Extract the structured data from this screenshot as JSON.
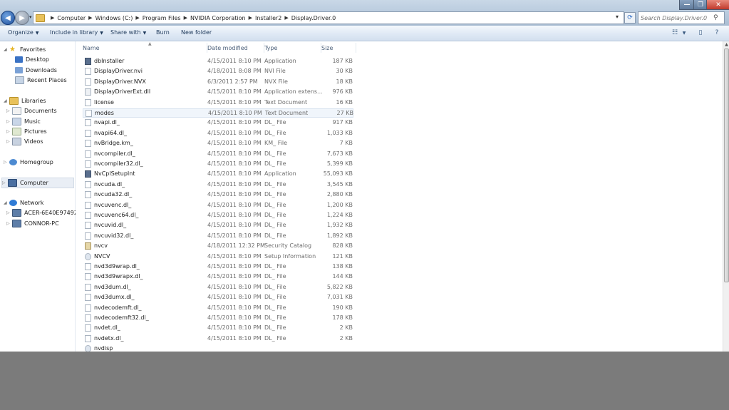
{
  "window": {
    "controls": {
      "minimize": "—",
      "maximize": "❐",
      "close": "✕"
    }
  },
  "address": {
    "breadcrumbs": [
      "Computer",
      "Windows (C:)",
      "Program Files",
      "NVIDIA Corporation",
      "Installer2",
      "Display.Driver.0"
    ],
    "search_placeholder": "Search Display.Driver.0"
  },
  "toolbar": {
    "organize": "Organize",
    "include_in_library": "Include in library",
    "share_with": "Share with",
    "burn": "Burn",
    "new_folder": "New folder"
  },
  "nav": {
    "favorites": "Favorites",
    "desktop": "Desktop",
    "downloads": "Downloads",
    "recent_places": "Recent Places",
    "libraries": "Libraries",
    "documents": "Documents",
    "music": "Music",
    "pictures": "Pictures",
    "videos": "Videos",
    "homegroup": "Homegroup",
    "computer": "Computer",
    "network": "Network",
    "acer": "ACER-6E40E97492",
    "connor": "CONNOR-PC"
  },
  "columns": {
    "name": "Name",
    "date": "Date modified",
    "type": "Type",
    "size": "Size"
  },
  "files": [
    {
      "name": "dbInstaller",
      "date": "4/15/2011 8:10 PM",
      "type": "Application",
      "size": "187 KB",
      "icon": "app"
    },
    {
      "name": "DisplayDriver.nvi",
      "date": "4/18/2011 8:08 PM",
      "type": "NVI File",
      "size": "30 KB",
      "icon": "file"
    },
    {
      "name": "DisplayDriver.NVX",
      "date": "6/3/2011 2:57 PM",
      "type": "NVX File",
      "size": "18 KB",
      "icon": "file"
    },
    {
      "name": "DisplayDriverExt.dll",
      "date": "4/15/2011 8:10 PM",
      "type": "Application extens...",
      "size": "976 KB",
      "icon": "dll"
    },
    {
      "name": "license",
      "date": "4/15/2011 8:10 PM",
      "type": "Text Document",
      "size": "16 KB",
      "icon": "txt"
    },
    {
      "name": "modes",
      "date": "4/15/2011 8:10 PM",
      "type": "Text Document",
      "size": "27 KB",
      "icon": "txt"
    },
    {
      "name": "nvapi.dl_",
      "date": "4/15/2011 8:10 PM",
      "type": "DL_ File",
      "size": "917 KB",
      "icon": "file"
    },
    {
      "name": "nvapi64.dl_",
      "date": "4/15/2011 8:10 PM",
      "type": "DL_ File",
      "size": "1,033 KB",
      "icon": "file"
    },
    {
      "name": "nvBridge.km_",
      "date": "4/15/2011 8:10 PM",
      "type": "KM_ File",
      "size": "7 KB",
      "icon": "file"
    },
    {
      "name": "nvcompiler.dl_",
      "date": "4/15/2011 8:10 PM",
      "type": "DL_ File",
      "size": "7,673 KB",
      "icon": "file"
    },
    {
      "name": "nvcompiler32.dl_",
      "date": "4/15/2011 8:10 PM",
      "type": "DL_ File",
      "size": "5,399 KB",
      "icon": "file"
    },
    {
      "name": "NvCplSetupInt",
      "date": "4/15/2011 8:10 PM",
      "type": "Application",
      "size": "55,093 KB",
      "icon": "app"
    },
    {
      "name": "nvcuda.dl_",
      "date": "4/15/2011 8:10 PM",
      "type": "DL_ File",
      "size": "3,545 KB",
      "icon": "file"
    },
    {
      "name": "nvcuda32.dl_",
      "date": "4/15/2011 8:10 PM",
      "type": "DL_ File",
      "size": "2,880 KB",
      "icon": "file"
    },
    {
      "name": "nvcuvenc.dl_",
      "date": "4/15/2011 8:10 PM",
      "type": "DL_ File",
      "size": "1,200 KB",
      "icon": "file"
    },
    {
      "name": "nvcuvenc64.dl_",
      "date": "4/15/2011 8:10 PM",
      "type": "DL_ File",
      "size": "1,224 KB",
      "icon": "file"
    },
    {
      "name": "nvcuvid.dl_",
      "date": "4/15/2011 8:10 PM",
      "type": "DL_ File",
      "size": "1,932 KB",
      "icon": "file"
    },
    {
      "name": "nvcuvid32.dl_",
      "date": "4/15/2011 8:10 PM",
      "type": "DL_ File",
      "size": "1,892 KB",
      "icon": "file"
    },
    {
      "name": "nvcv",
      "date": "4/18/2011 12:32 PM",
      "type": "Security Catalog",
      "size": "828 KB",
      "icon": "cat"
    },
    {
      "name": "NVCV",
      "date": "4/15/2011 8:10 PM",
      "type": "Setup Information",
      "size": "121 KB",
      "icon": "inf"
    },
    {
      "name": "nvd3d9wrap.dl_",
      "date": "4/15/2011 8:10 PM",
      "type": "DL_ File",
      "size": "138 KB",
      "icon": "file"
    },
    {
      "name": "nvd3d9wrapx.dl_",
      "date": "4/15/2011 8:10 PM",
      "type": "DL_ File",
      "size": "144 KB",
      "icon": "file"
    },
    {
      "name": "nvd3dum.dl_",
      "date": "4/15/2011 8:10 PM",
      "type": "DL_ File",
      "size": "5,822 KB",
      "icon": "file"
    },
    {
      "name": "nvd3dumx.dl_",
      "date": "4/15/2011 8:10 PM",
      "type": "DL_ File",
      "size": "7,031 KB",
      "icon": "file"
    },
    {
      "name": "nvdecodemft.dl_",
      "date": "4/15/2011 8:10 PM",
      "type": "DL_ File",
      "size": "190 KB",
      "icon": "file"
    },
    {
      "name": "nvdecodemft32.dl_",
      "date": "4/15/2011 8:10 PM",
      "type": "DL_ File",
      "size": "178 KB",
      "icon": "file"
    },
    {
      "name": "nvdet.dl_",
      "date": "4/15/2011 8:10 PM",
      "type": "DL_ File",
      "size": "2 KB",
      "icon": "file"
    },
    {
      "name": "nvdetx.dl_",
      "date": "4/15/2011 8:10 PM",
      "type": "DL_ File",
      "size": "2 KB",
      "icon": "file"
    },
    {
      "name": "nvdisp",
      "date": "",
      "type": "",
      "size": "",
      "icon": "inf"
    }
  ],
  "highlighted_file_index": 5
}
